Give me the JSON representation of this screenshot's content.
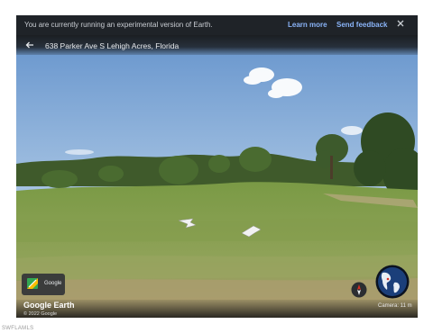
{
  "banner": {
    "message": "You are currently running an experimental version of Earth.",
    "learn_more": "Learn more",
    "send_feedback": "Send feedback"
  },
  "titlebar": {
    "address": "638 Parker Ave S Lehigh Acres, Florida"
  },
  "layers_button": {
    "label": "Google",
    "icon": "map-layers-icon"
  },
  "footer": {
    "logo_text": "Google Earth",
    "copyright": "© 2022 Google",
    "camera": "Camera: 11 m"
  },
  "watermark": "SWFLAMLS",
  "colors": {
    "sky_top": "#6f9bd0",
    "sky_bottom": "#c7d9ea",
    "grass": "#7e9a4a",
    "dirt": "#a3966a",
    "banner_bg": "#1f2328",
    "link": "#8ab4f8"
  },
  "icons": {
    "close": "close-icon",
    "back": "back-arrow-icon",
    "compass": "compass-icon",
    "globe": "globe-icon"
  }
}
